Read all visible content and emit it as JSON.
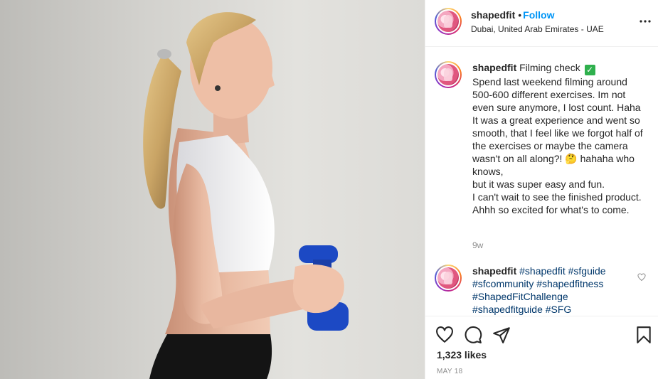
{
  "post": {
    "username": "shapedfit",
    "follow_label": "Follow",
    "separator": "•",
    "location": "Dubai, United Arab Emirates - UAE"
  },
  "caption": {
    "username": "shapedfit",
    "title": "Filming check",
    "badge": "✓",
    "text": "Spend last weekend filming around 500-600 different exercises. Im not even sure anymore, I lost count. Haha It was a great experience and went so smooth, that I feel like we forgot half of the exercises or maybe the camera wasn't on all along?! 🤔 hahaha who knows,\nbut it was super easy and fun.\nI can't wait to see the finished product. Ahhh so excited for what's to come.",
    "time_ago": "9w"
  },
  "comment": {
    "username": "shapedfit",
    "hashtags_line1": "#shapedfit #sfguide",
    "hashtags_line2": "#sfcommunity #shapedfitness",
    "hashtags_line3": "#ShapedFitChallenge",
    "hashtags_line4": "#shapedfitguide #SFG"
  },
  "stats": {
    "likes": "1,323 likes",
    "date": "MAY 18"
  },
  "icons": {
    "more": "more-options-icon",
    "like": "heart-icon",
    "comment": "comment-icon",
    "share": "share-icon",
    "save": "bookmark-icon"
  },
  "colors": {
    "link_blue": "#0095f6",
    "hashtag_blue": "#00376b",
    "muted": "#8e8e8e",
    "dumbbell_blue": "#1c49c4"
  }
}
